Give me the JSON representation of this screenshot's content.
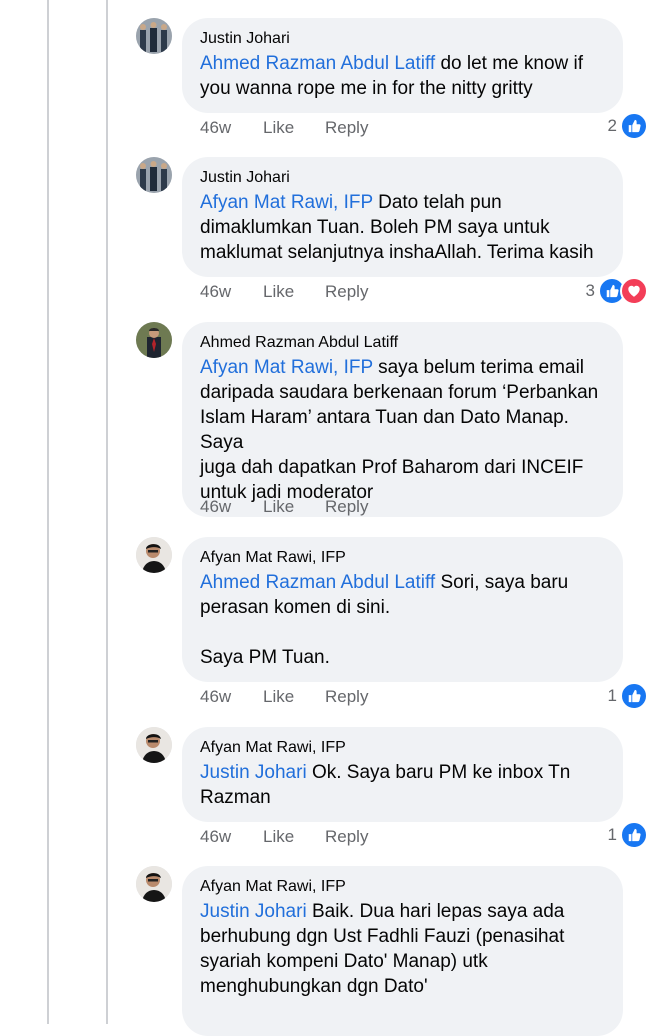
{
  "comments": [
    {
      "author": "Justin Johari",
      "mention": "Ahmed Razman Abdul Latiff",
      "text": " do let me know if\nyou wanna rope me in for the nitty gritty",
      "time": "46w",
      "like_label": "Like",
      "reply_label": "Reply",
      "reaction_count": "2",
      "reactions": [
        "like"
      ]
    },
    {
      "author": "Justin Johari",
      "mention": "Afyan Mat Rawi, IFP",
      "text": " Dato telah pun\ndimaklumkan Tuan. Boleh PM saya untuk\nmaklumat selanjutnya inshaAllah. Terima kasih",
      "time": "46w",
      "like_label": "Like",
      "reply_label": "Reply",
      "reaction_count": "3",
      "reactions": [
        "like",
        "love"
      ]
    },
    {
      "author": "Ahmed Razman Abdul Latiff",
      "mention": "Afyan Mat Rawi, IFP",
      "text": " saya belum terima email\ndaripada saudara berkenaan forum ‘Perbankan\nIslam Haram’ antara Tuan dan Dato Manap. Saya\njuga dah dapatkan Prof Baharom dari INCEIF\nuntuk jadi moderator",
      "time": "46w",
      "like_label": "Like",
      "reply_label": "Reply",
      "reaction_count": "",
      "reactions": []
    },
    {
      "author": "Afyan Mat Rawi, IFP",
      "mention": "Ahmed Razman Abdul Latiff",
      "text": " Sori, saya baru\nperasan komen di sini.\n\nSaya PM Tuan.",
      "time": "46w",
      "like_label": "Like",
      "reply_label": "Reply",
      "reaction_count": "1",
      "reactions": [
        "like"
      ]
    },
    {
      "author": "Afyan Mat Rawi, IFP",
      "mention": "Justin Johari",
      "text": " Ok. Saya baru PM ke inbox Tn\nRazman",
      "time": "46w",
      "like_label": "Like",
      "reply_label": "Reply",
      "reaction_count": "1",
      "reactions": [
        "like"
      ]
    },
    {
      "author": "Afyan Mat Rawi, IFP",
      "mention": "Justin Johari",
      "text": " Baik. Dua hari lepas saya ada\nberhubung dgn Ust Fadhli Fauzi (penasihat\nsyariah kompeni Dato' Manap) utk\nmenghubungkan dgn Dato'",
      "time": "",
      "like_label": "",
      "reply_label": "",
      "reaction_count": "",
      "reactions": []
    }
  ],
  "colors": {
    "mention": "#216fdb",
    "bubble": "#f0f2f5",
    "meta": "#65676b",
    "like": "#1877f2",
    "love": "#f33e58"
  },
  "icons": {
    "like": "thumbs-up-icon",
    "love": "heart-icon"
  }
}
